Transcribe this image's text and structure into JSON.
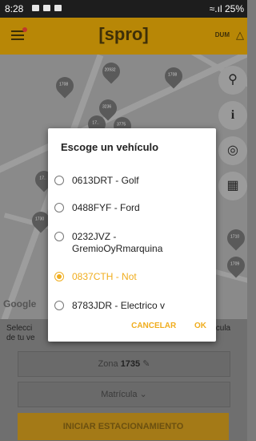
{
  "status": {
    "time": "8:28",
    "battery": "25%"
  },
  "app": {
    "logo": "[spro]",
    "mode_label": "DUM",
    "brand_color": "#b88706",
    "accent_color": "#f0ad1e"
  },
  "map": {
    "attribution": "Google",
    "pins": [
      "1708",
      "20932",
      "1708",
      "3236",
      "17..",
      "3775",
      "17..",
      "1730",
      "1710",
      "1709"
    ]
  },
  "dialog": {
    "title": "Escoge un vehículo",
    "options": [
      {
        "label": "0613DRT - Golf",
        "selected": false
      },
      {
        "label": "0488FYF - Ford",
        "selected": false
      },
      {
        "label": "0232JVZ - GremioOyRmarquina",
        "selected": false
      },
      {
        "label": "0837CTH - Not",
        "selected": true
      },
      {
        "label": "8783JDR - Electrico v",
        "selected": false
      }
    ],
    "cancel": "CANCELAR",
    "ok": "OK"
  },
  "form": {
    "prompt_left": "Selecci\nde tu ve",
    "prompt_right": "matrícula",
    "zone_label": "Zona",
    "zone_value": "1735",
    "plate_label": "Matrícula",
    "start_button": "INICIAR ESTACIONAMIENTO"
  }
}
